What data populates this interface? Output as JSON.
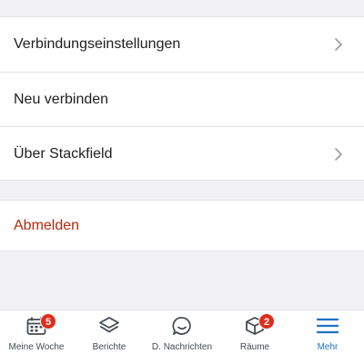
{
  "settings": {
    "items": [
      {
        "label": "Verbindungseinstellungen",
        "chevron": true
      },
      {
        "label": "Neu verbinden",
        "chevron": false
      },
      {
        "label": "Über Stackfield",
        "chevron": true
      }
    ]
  },
  "logout": {
    "label": "Abmelden",
    "color": "#b3290d"
  },
  "tabbar": {
    "tabs": [
      {
        "label": "Meine Woche",
        "icon": "calendar-icon",
        "badge": "5"
      },
      {
        "label": "Berichte",
        "icon": "layers-icon"
      },
      {
        "label": "D. Nachrichten",
        "icon": "chat-bubble-icon"
      },
      {
        "label": "Räume",
        "icon": "cube-icon",
        "badge": "2"
      },
      {
        "label": "Mehr",
        "icon": "menu-icon",
        "active": true
      }
    ],
    "accent": "#1a73c8",
    "badge_color": "#e02d1b"
  }
}
